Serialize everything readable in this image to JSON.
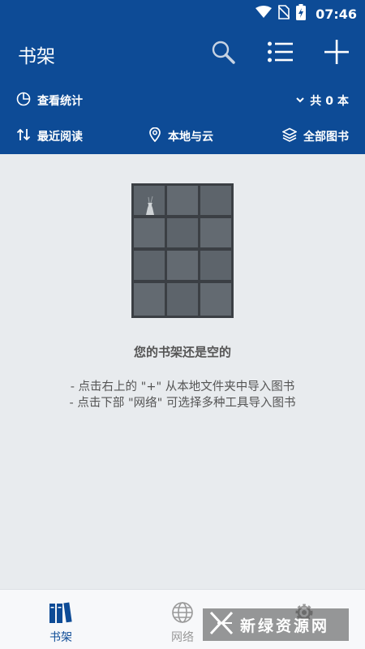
{
  "status_bar": {
    "time": "07:46",
    "icons": [
      "wifi-icon",
      "no-sim-icon",
      "battery-charging-icon"
    ]
  },
  "app_bar": {
    "title": "书架",
    "actions": [
      "search-icon",
      "list-view-icon",
      "add-icon"
    ]
  },
  "stats_row": {
    "view_stats_label": "查看统计",
    "count_prefix": "共",
    "count": "0",
    "count_suffix": "本"
  },
  "filter_row": {
    "sort_label": "最近阅读",
    "source_label": "本地与云",
    "category_label": "全部图书"
  },
  "empty_state": {
    "title": "您的书架还是空的",
    "tip1": "- 点击右上的 \"+\" 从本地文件夹中导入图书",
    "tip2": "- 点击下部 \"网络\" 可选择多种工具导入图书"
  },
  "bottom_nav": {
    "items": [
      {
        "label": "书架",
        "icon": "bookshelf-icon",
        "active": true
      },
      {
        "label": "网络",
        "icon": "globe-icon",
        "active": false
      },
      {
        "label": "",
        "icon": "gear-icon",
        "active": false
      }
    ]
  },
  "watermark": {
    "text": "新绿资源网"
  },
  "colors": {
    "primary": "#0d4b96",
    "background": "#e8ebee",
    "muted_text": "#555555",
    "inactive_nav": "#999999"
  }
}
